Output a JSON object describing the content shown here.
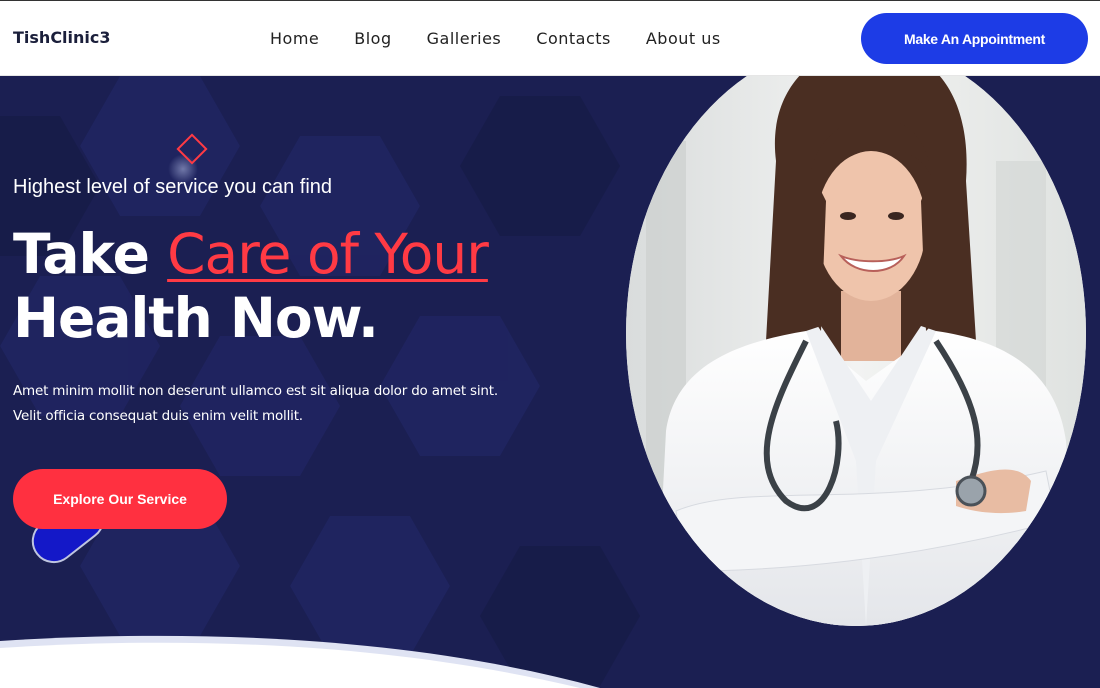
{
  "header": {
    "logo": "TishClinic3",
    "nav": [
      "Home",
      "Blog",
      "Galleries",
      "Contacts",
      "About us"
    ],
    "cta_label": "Make An Appointment"
  },
  "hero": {
    "tagline": "Highest level of service you can find",
    "headline": {
      "word1": "Take",
      "accent": "Care of Your",
      "line2": "Health Now."
    },
    "description_line1": "Amet minim mollit non deserunt ullamco est sit aliqua dolor do amet sint.",
    "description_line2": "Velit officia consequat duis enim velit mollit.",
    "button_label": "Explore Our Service"
  },
  "colors": {
    "brand_blue": "#1d3ce6",
    "accent_red": "#ff3a44",
    "hero_bg": "#1b1f52"
  },
  "icons": [
    "diamond-outline-icon",
    "pill-decoration-icon"
  ]
}
